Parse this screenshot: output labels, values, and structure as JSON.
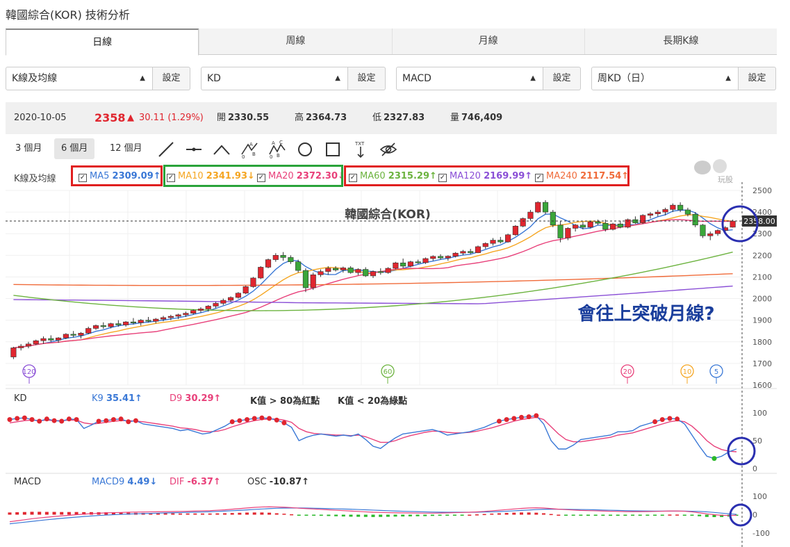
{
  "page_title": "韓國綜合(KOR) 技術分析",
  "tabs": [
    "日線",
    "周線",
    "月線",
    "長期K線"
  ],
  "selectors": [
    {
      "value": "K線及均線",
      "button": "設定"
    },
    {
      "value": "KD",
      "button": "設定"
    },
    {
      "value": "MACD",
      "button": "設定"
    },
    {
      "value": "周KD（日）",
      "button": "設定"
    }
  ],
  "quote": {
    "date": "2020-10-05",
    "price": "2358",
    "change": "30.11 (1.29%)",
    "open_label": "開",
    "open": "2330.55",
    "high_label": "高",
    "high": "2364.73",
    "low_label": "低",
    "low": "2327.83",
    "vol_label": "量",
    "vol": "746,409"
  },
  "ranges": [
    "3 個月",
    "6 個月",
    "12 個月"
  ],
  "tool_icons": [
    "line-tool-icon",
    "segment-tool-icon",
    "angle-tool-icon",
    "abc-pattern-icon",
    "abcd-pattern-icon",
    "circle-tool-icon",
    "rect-tool-icon",
    "text-tool-icon",
    "hide-drawings-icon"
  ],
  "legend": {
    "label": "K線及均線",
    "items": [
      {
        "name": "MA5",
        "value": "2309.09↑",
        "color": "#3a78d6"
      },
      {
        "name": "MA10",
        "value": "2341.93↓",
        "color": "#f5a623"
      },
      {
        "name": "MA20",
        "value": "2372.30↓",
        "color": "#e8407a"
      },
      {
        "name": "MA60",
        "value": "2315.29↑",
        "color": "#6cb33f"
      },
      {
        "name": "MA120",
        "value": "2169.99↑",
        "color": "#8a4fd6"
      },
      {
        "name": "MA240",
        "value": "2117.54↑",
        "color": "#f06b3a"
      }
    ]
  },
  "watermark": "玩股網",
  "chart_data": {
    "type": "candlestick",
    "title": "韓國綜合(KOR)",
    "ylim": [
      1600,
      2500
    ],
    "yticks": [
      "2500",
      "2400",
      "2300",
      "2200",
      "2100",
      "2000",
      "1900",
      "1800",
      "1700",
      "1600"
    ],
    "current_price_label": "2358.00",
    "annotation": "會往上突破月線?",
    "period_markers": [
      "120",
      "60",
      "20",
      "10",
      "5"
    ],
    "candles": [
      [
        1730,
        1777,
        1720,
        1772
      ],
      [
        1772,
        1790,
        1760,
        1780
      ],
      [
        1780,
        1800,
        1770,
        1790
      ],
      [
        1790,
        1810,
        1785,
        1805
      ],
      [
        1805,
        1825,
        1790,
        1815
      ],
      [
        1815,
        1830,
        1800,
        1808
      ],
      [
        1808,
        1822,
        1795,
        1818
      ],
      [
        1818,
        1840,
        1812,
        1835
      ],
      [
        1835,
        1850,
        1820,
        1830
      ],
      [
        1830,
        1845,
        1815,
        1840
      ],
      [
        1840,
        1870,
        1835,
        1862
      ],
      [
        1862,
        1880,
        1855,
        1875
      ],
      [
        1875,
        1890,
        1860,
        1870
      ],
      [
        1870,
        1888,
        1862,
        1884
      ],
      [
        1884,
        1900,
        1870,
        1878
      ],
      [
        1878,
        1896,
        1870,
        1892
      ],
      [
        1892,
        1910,
        1880,
        1888
      ],
      [
        1888,
        1905,
        1875,
        1900
      ],
      [
        1900,
        1915,
        1890,
        1895
      ],
      [
        1895,
        1910,
        1885,
        1905
      ],
      [
        1905,
        1920,
        1895,
        1912
      ],
      [
        1912,
        1925,
        1900,
        1918
      ],
      [
        1918,
        1930,
        1905,
        1925
      ],
      [
        1925,
        1940,
        1915,
        1932
      ],
      [
        1932,
        1950,
        1925,
        1945
      ],
      [
        1945,
        1960,
        1935,
        1952
      ],
      [
        1952,
        1970,
        1940,
        1965
      ],
      [
        1965,
        1985,
        1955,
        1978
      ],
      [
        1978,
        2000,
        1970,
        1992
      ],
      [
        1992,
        2010,
        1985,
        2005
      ],
      [
        2005,
        2030,
        2000,
        2025
      ],
      [
        2025,
        2060,
        2020,
        2055
      ],
      [
        2055,
        2100,
        2050,
        2095
      ],
      [
        2095,
        2150,
        2090,
        2145
      ],
      [
        2145,
        2185,
        2140,
        2180
      ],
      [
        2180,
        2210,
        2170,
        2200
      ],
      [
        2200,
        2215,
        2175,
        2190
      ],
      [
        2190,
        2200,
        2160,
        2170
      ],
      [
        2170,
        2180,
        2120,
        2130
      ],
      [
        2130,
        2140,
        2030,
        2050
      ],
      [
        2050,
        2120,
        2040,
        2110
      ],
      [
        2110,
        2135,
        2100,
        2125
      ],
      [
        2125,
        2150,
        2110,
        2140
      ],
      [
        2140,
        2150,
        2125,
        2132
      ],
      [
        2132,
        2148,
        2120,
        2142
      ],
      [
        2142,
        2150,
        2115,
        2120
      ],
      [
        2120,
        2140,
        2108,
        2135
      ],
      [
        2135,
        2145,
        2100,
        2105
      ],
      [
        2105,
        2130,
        2095,
        2125
      ],
      [
        2125,
        2140,
        2110,
        2120
      ],
      [
        2120,
        2145,
        2115,
        2140
      ],
      [
        2140,
        2170,
        2135,
        2165
      ],
      [
        2165,
        2185,
        2140,
        2150
      ],
      [
        2150,
        2175,
        2145,
        2170
      ],
      [
        2170,
        2180,
        2160,
        2166
      ],
      [
        2166,
        2190,
        2160,
        2185
      ],
      [
        2185,
        2200,
        2175,
        2195
      ],
      [
        2195,
        2205,
        2180,
        2188
      ],
      [
        2188,
        2200,
        2175,
        2196
      ],
      [
        2196,
        2215,
        2190,
        2210
      ],
      [
        2210,
        2225,
        2200,
        2218
      ],
      [
        2218,
        2230,
        2205,
        2212
      ],
      [
        2212,
        2245,
        2210,
        2240
      ],
      [
        2240,
        2260,
        2230,
        2255
      ],
      [
        2255,
        2280,
        2245,
        2270
      ],
      [
        2270,
        2285,
        2255,
        2262
      ],
      [
        2262,
        2300,
        2258,
        2295
      ],
      [
        2295,
        2340,
        2290,
        2335
      ],
      [
        2335,
        2375,
        2330,
        2370
      ],
      [
        2370,
        2410,
        2360,
        2400
      ],
      [
        2400,
        2450,
        2395,
        2445
      ],
      [
        2445,
        2455,
        2390,
        2400
      ],
      [
        2400,
        2410,
        2330,
        2340
      ],
      [
        2340,
        2360,
        2260,
        2280
      ],
      [
        2280,
        2330,
        2270,
        2325
      ],
      [
        2325,
        2345,
        2310,
        2340
      ],
      [
        2340,
        2355,
        2320,
        2330
      ],
      [
        2330,
        2360,
        2325,
        2355
      ],
      [
        2355,
        2365,
        2340,
        2348
      ],
      [
        2348,
        2365,
        2310,
        2320
      ],
      [
        2320,
        2350,
        2315,
        2345
      ],
      [
        2345,
        2360,
        2325,
        2330
      ],
      [
        2330,
        2370,
        2325,
        2365
      ],
      [
        2365,
        2380,
        2345,
        2350
      ],
      [
        2350,
        2390,
        2345,
        2385
      ],
      [
        2385,
        2400,
        2370,
        2392
      ],
      [
        2392,
        2410,
        2380,
        2400
      ],
      [
        2400,
        2420,
        2385,
        2412
      ],
      [
        2412,
        2440,
        2400,
        2432
      ],
      [
        2432,
        2445,
        2400,
        2410
      ],
      [
        2410,
        2420,
        2380,
        2390
      ],
      [
        2390,
        2400,
        2330,
        2340
      ],
      [
        2340,
        2345,
        2280,
        2290
      ],
      [
        2290,
        2310,
        2270,
        2300
      ],
      [
        2300,
        2320,
        2290,
        2315
      ],
      [
        2315,
        2335,
        2305,
        2328
      ],
      [
        2330,
        2365,
        2328,
        2358
      ]
    ]
  },
  "kd": {
    "label": "KD",
    "k_label": "K9",
    "k_value": "35.41↑",
    "d_label": "D9",
    "d_value": "30.29↑",
    "note1": "K值 > 80為紅點",
    "note2": "K值 < 20為綠點",
    "yticks": [
      "100",
      "50",
      "0"
    ],
    "k_series": [
      88,
      90,
      91,
      88,
      85,
      89,
      86,
      85,
      89,
      88,
      72,
      78,
      85,
      86,
      88,
      89,
      84,
      86,
      80,
      78,
      76,
      74,
      72,
      68,
      70,
      66,
      62,
      64,
      70,
      76,
      84,
      86,
      88,
      90,
      91,
      90,
      87,
      82,
      74,
      50,
      56,
      60,
      62,
      60,
      58,
      60,
      58,
      62,
      52,
      40,
      36,
      46,
      55,
      62,
      64,
      66,
      68,
      70,
      66,
      60,
      62,
      64,
      66,
      70,
      74,
      80,
      85,
      88,
      90,
      92,
      93,
      95,
      80,
      50,
      35,
      35,
      42,
      52,
      54,
      56,
      58,
      60,
      66,
      66,
      68,
      76,
      80,
      84,
      88,
      90,
      89,
      80,
      60,
      40,
      22,
      18,
      22,
      30,
      35
    ],
    "d_series": [
      82,
      84,
      86,
      87,
      86,
      87,
      86,
      86,
      87,
      87,
      82,
      80,
      81,
      83,
      85,
      86,
      86,
      85,
      84,
      82,
      80,
      78,
      76,
      73,
      72,
      70,
      67,
      66,
      67,
      70,
      75,
      79,
      83,
      86,
      88,
      89,
      89,
      87,
      83,
      72,
      66,
      63,
      62,
      61,
      60,
      60,
      59,
      60,
      57,
      52,
      47,
      47,
      50,
      55,
      59,
      62,
      65,
      67,
      67,
      65,
      64,
      64,
      65,
      67,
      70,
      73,
      77,
      81,
      85,
      88,
      90,
      92,
      88,
      75,
      62,
      52,
      48,
      48,
      50,
      52,
      54,
      56,
      60,
      62,
      64,
      68,
      72,
      76,
      80,
      84,
      86,
      84,
      76,
      64,
      50,
      40,
      34,
      31,
      30
    ]
  },
  "macd": {
    "label": "MACD",
    "m_label": "MACD9",
    "m_value": "4.49↓",
    "dif_label": "DIF",
    "dif_value": "-6.37↑",
    "osc_label": "OSC",
    "osc_value": "-10.87↑",
    "yticks": [
      "100",
      "0",
      "-100"
    ],
    "dif": [
      -70,
      -60,
      -50,
      -40,
      -32,
      -25,
      -18,
      -12,
      -6,
      0,
      5,
      10,
      14,
      18,
      20,
      22,
      24,
      26,
      27,
      28,
      29,
      30,
      31,
      32,
      34,
      36,
      38,
      40,
      44,
      48,
      54,
      60,
      66,
      72,
      76,
      78,
      76,
      74,
      70,
      64,
      60,
      56,
      52,
      48,
      44,
      40,
      36,
      32,
      28,
      24,
      22,
      20,
      19,
      18,
      17,
      16,
      15,
      15,
      16,
      18,
      20,
      22,
      24,
      28,
      32,
      38,
      44,
      50,
      56,
      62,
      66,
      68,
      66,
      60,
      54,
      50,
      46,
      42,
      40,
      38,
      36,
      34,
      32,
      30,
      30,
      30,
      31,
      32,
      34,
      36,
      36,
      34,
      28,
      18,
      8,
      0,
      -6,
      -8,
      -6
    ],
    "macd": [
      -90,
      -82,
      -74,
      -66,
      -58,
      -50,
      -43,
      -36,
      -30,
      -24,
      -18,
      -13,
      -8,
      -4,
      0,
      3,
      6,
      9,
      11,
      13,
      15,
      17,
      19,
      21,
      23,
      25,
      27,
      29,
      32,
      35,
      39,
      43,
      47,
      52,
      56,
      60,
      63,
      65,
      66,
      66,
      65,
      64,
      62,
      60,
      58,
      56,
      54,
      51,
      48,
      45,
      42,
      39,
      36,
      34,
      32,
      30,
      28,
      26,
      25,
      24,
      24,
      24,
      24,
      25,
      26,
      28,
      31,
      34,
      38,
      42,
      46,
      50,
      53,
      54,
      54,
      53,
      52,
      51,
      50,
      48,
      46,
      44,
      42,
      40,
      38,
      37,
      36,
      35,
      35,
      35,
      35,
      35,
      34,
      32,
      28,
      22,
      15,
      9,
      4
    ]
  }
}
